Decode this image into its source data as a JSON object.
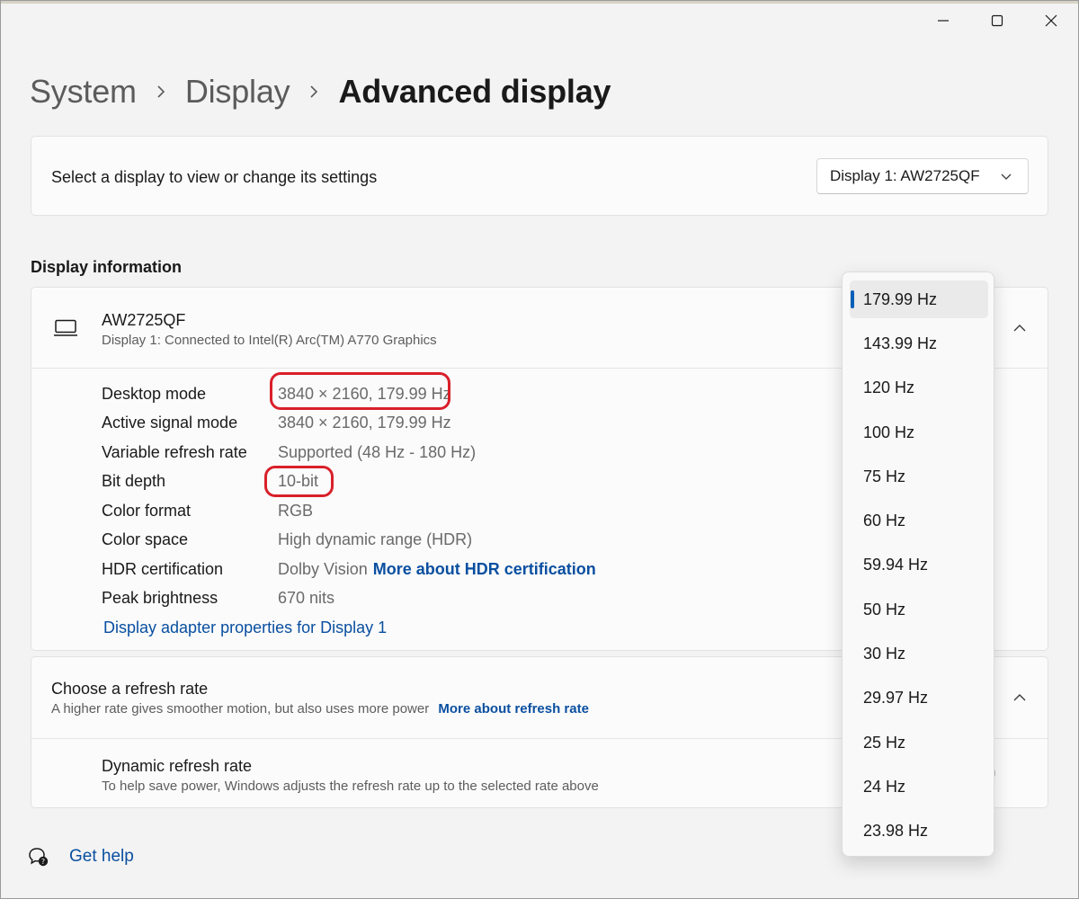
{
  "breadcrumb": {
    "items": [
      "System",
      "Display"
    ],
    "current": "Advanced display"
  },
  "select_display": {
    "label": "Select a display to view or change its settings",
    "dropdown_value": "Display 1: AW2725QF"
  },
  "display_info": {
    "section_title": "Display information",
    "monitor_name": "AW2725QF",
    "monitor_subtitle": "Display 1: Connected to Intel(R) Arc(TM) A770 Graphics",
    "rows": [
      {
        "label": "Desktop mode",
        "value": "3840 × 2160, 179.99 Hz"
      },
      {
        "label": "Active signal mode",
        "value": "3840 × 2160, 179.99 Hz"
      },
      {
        "label": "Variable refresh rate",
        "value": "Supported (48 Hz - 180 Hz)"
      },
      {
        "label": "Bit depth",
        "value": "10-bit"
      },
      {
        "label": "Color format",
        "value": "RGB"
      },
      {
        "label": "Color space",
        "value": "High dynamic range (HDR)"
      },
      {
        "label": "HDR certification",
        "value": "Dolby Vision",
        "link": "More about HDR certification"
      },
      {
        "label": "Peak brightness",
        "value": "670 nits"
      }
    ],
    "adapter_link": "Display adapter properties for Display 1"
  },
  "refresh_rate": {
    "title": "Choose a refresh rate",
    "subtitle": "A higher rate gives smoother motion, but also uses more power",
    "link": "More about refresh rate",
    "dynamic_title": "Dynamic refresh rate",
    "dynamic_subtitle": "To help save power, Windows adjusts the refresh rate up to the selected rate above"
  },
  "refresh_options": [
    "179.99 Hz",
    "143.99 Hz",
    "120 Hz",
    "100 Hz",
    "75 Hz",
    "60 Hz",
    "59.94 Hz",
    "50 Hz",
    "30 Hz",
    "29.97 Hz",
    "25 Hz",
    "24 Hz",
    "23.98 Hz"
  ],
  "selected_option": "179.99 Hz",
  "help": {
    "label": "Get help"
  },
  "colors": {
    "accent": "#005fb8",
    "link": "#0a4fa0",
    "annotation": "#d9202a"
  }
}
